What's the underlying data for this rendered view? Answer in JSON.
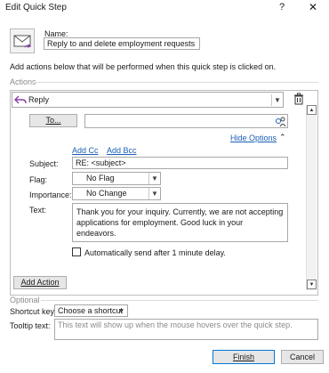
{
  "window": {
    "title": "Edit Quick Step",
    "help_label": "?",
    "close_label": "✕"
  },
  "name": {
    "label": "Name:",
    "value": "Reply to and delete employment requests"
  },
  "instructions": "Add actions below that will be performed when this quick step is clicked on.",
  "actions_header": "Actions",
  "action": {
    "selected": "Reply",
    "to_button": "To...",
    "to_value": "",
    "hide_options": "Hide Options",
    "add_cc": "Add Cc",
    "add_bcc": "Add Bcc",
    "subject_label": "Subject:",
    "subject_value": "RE: <subject>",
    "flag_label": "Flag:",
    "flag_value": "No Flag",
    "importance_label": "Importance:",
    "importance_value": "No Change",
    "text_label": "Text:",
    "text_value": "Thank you for your inquiry. Currently, we are not accepting applications for employment. Good luck in your endeavors.",
    "auto_send_label": "Automatically send after 1 minute delay.",
    "auto_send_checked": false
  },
  "add_action_button": "Add Action",
  "optional_header": "Optional",
  "shortcut": {
    "label": "Shortcut key:",
    "value": "Choose a shortcut"
  },
  "tooltip": {
    "label": "Tooltip text:",
    "placeholder": "This text will show up when the mouse hovers over the quick step."
  },
  "footer": {
    "finish": "Finish",
    "cancel": "Cancel"
  },
  "colors": {
    "accent": "#0078d7",
    "link": "#1a5fb4",
    "border": "#a8a8a8"
  }
}
